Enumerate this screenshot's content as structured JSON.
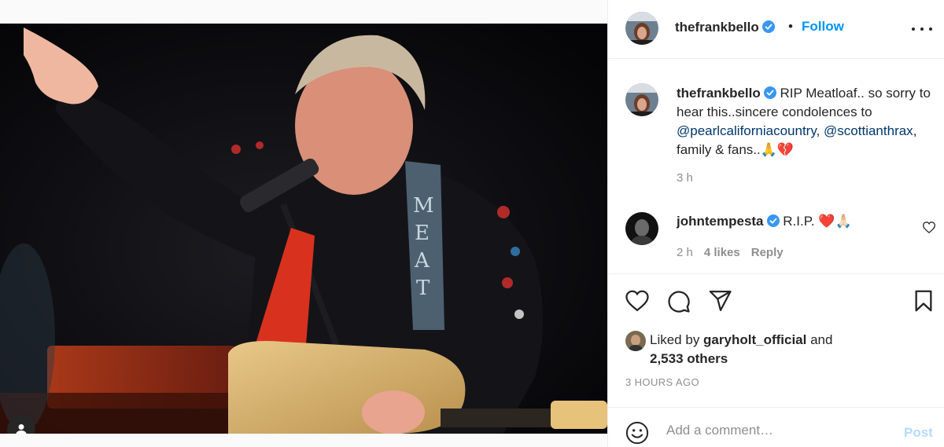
{
  "post": {
    "author": "thefrankbello",
    "follow_label": "Follow",
    "separator": "•",
    "caption": {
      "username": "thefrankbello",
      "text_1": " RIP Meatloaf.. so sorry to hear this..sincere condolences to ",
      "mention_1": "@pearlcaliforniacountry",
      "text_2": ", ",
      "mention_2": "@scottianthrax",
      "text_3": ", family & fans..🙏💔",
      "time": "3 h"
    },
    "comment": {
      "username": "johntempesta",
      "text": " R.I.P. ❤️🙏🏻",
      "time": "2 h",
      "likes": "4 likes",
      "reply_label": "Reply"
    },
    "likes": {
      "liked_by_prefix": "Liked by ",
      "liked_by_user": "garyholt_official",
      "liked_by_suffix": " and",
      "others": "2,533 others"
    },
    "timestamp": "3 HOURS AGO",
    "add_comment": {
      "placeholder": "Add a comment…",
      "post_label": "Post"
    },
    "photo_text": "MEAT"
  },
  "colors": {
    "accent": "#0095f6",
    "mention": "#00376b",
    "muted": "#8e8e8e",
    "post_disabled": "#b3dbff",
    "verified": "#3897f0"
  },
  "icons": [
    "verified-icon",
    "more-options-icon",
    "heart-icon",
    "comment-icon",
    "share-icon",
    "bookmark-icon",
    "emoji-icon",
    "user-tag-icon"
  ]
}
